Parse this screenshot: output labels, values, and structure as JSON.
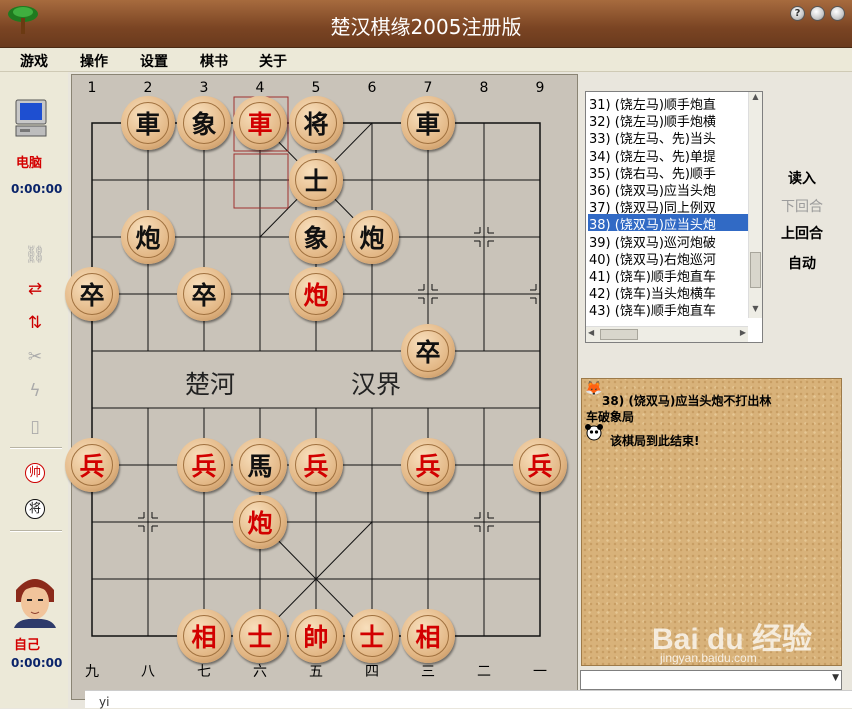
{
  "window": {
    "title": "楚汉棋缘2005注册版",
    "btn_help": "?",
    "btn_min": "",
    "btn_close": ""
  },
  "menu": [
    "游戏",
    "操作",
    "设置",
    "棋书",
    "关于"
  ],
  "players": {
    "computer": {
      "name": "电脑",
      "time": "0:00:00"
    },
    "self": {
      "name": "自己",
      "time": "0:00:00"
    }
  },
  "board": {
    "top_coords": [
      "1",
      "2",
      "3",
      "4",
      "5",
      "6",
      "7",
      "8",
      "9"
    ],
    "bottom_coords": [
      "九",
      "八",
      "七",
      "六",
      "五",
      "四",
      "三",
      "二",
      "一"
    ],
    "river_left": "楚河",
    "river_right": "汉界",
    "pieces": [
      {
        "char": "車",
        "side": "black",
        "file": 2,
        "rank": 0
      },
      {
        "char": "象",
        "side": "black",
        "file": 3,
        "rank": 0
      },
      {
        "char": "車",
        "side": "red",
        "file": 4,
        "rank": 0
      },
      {
        "char": "将",
        "side": "black",
        "file": 5,
        "rank": 0
      },
      {
        "char": "車",
        "side": "black",
        "file": 7,
        "rank": 0
      },
      {
        "char": "士",
        "side": "black",
        "file": 5,
        "rank": 1
      },
      {
        "char": "炮",
        "side": "black",
        "file": 2,
        "rank": 2
      },
      {
        "char": "象",
        "side": "black",
        "file": 5,
        "rank": 2
      },
      {
        "char": "炮",
        "side": "black",
        "file": 6,
        "rank": 2
      },
      {
        "char": "卒",
        "side": "black",
        "file": 1,
        "rank": 3
      },
      {
        "char": "卒",
        "side": "black",
        "file": 3,
        "rank": 3
      },
      {
        "char": "炮",
        "side": "red",
        "file": 5,
        "rank": 3
      },
      {
        "char": "卒",
        "side": "black",
        "file": 7,
        "rank": 4
      },
      {
        "char": "兵",
        "side": "red",
        "file": 1,
        "rank": 6
      },
      {
        "char": "兵",
        "side": "red",
        "file": 3,
        "rank": 6
      },
      {
        "char": "馬",
        "side": "black",
        "file": 4,
        "rank": 6
      },
      {
        "char": "兵",
        "side": "red",
        "file": 5,
        "rank": 6
      },
      {
        "char": "兵",
        "side": "red",
        "file": 7,
        "rank": 6
      },
      {
        "char": "兵",
        "side": "red",
        "file": 9,
        "rank": 6
      },
      {
        "char": "炮",
        "side": "red",
        "file": 4,
        "rank": 7
      },
      {
        "char": "相",
        "side": "red",
        "file": 3,
        "rank": 9
      },
      {
        "char": "士",
        "side": "red",
        "file": 4,
        "rank": 9
      },
      {
        "char": "帥",
        "side": "red",
        "file": 5,
        "rank": 9
      },
      {
        "char": "士",
        "side": "red",
        "file": 6,
        "rank": 9
      },
      {
        "char": "相",
        "side": "red",
        "file": 7,
        "rank": 9
      }
    ]
  },
  "move_list": [
    "31) (饶左马)顺手炮直",
    "32) (饶左马)顺手炮横",
    "33) (饶左马、先)当头",
    "34) (饶左马、先)单提",
    "35) (饶右马、先)顺手",
    "36) (饶双马)应当头炮",
    "37) (饶双马)同上例双",
    "38) (饶双马)应当头炮",
    "39) (饶双马)巡河炮破",
    "40) (饶双马)右炮巡河",
    "41) (饶车)顺手炮直车",
    "42) (饶车)当头炮横车",
    "43) (饶车)顺手炮直车"
  ],
  "selected_move": 7,
  "controls": {
    "load": "读入",
    "next": "下回合",
    "prev": "上回合",
    "auto": "自动"
  },
  "comment": {
    "line1": "38) (饶双马)应当头炮不打出林",
    "line2": "车破象局",
    "line3": "该棋局到此结束!"
  },
  "watermark": "Bai du 经验",
  "watermark_sub": "jingyan.baidu.com",
  "bottom_text": "yi"
}
